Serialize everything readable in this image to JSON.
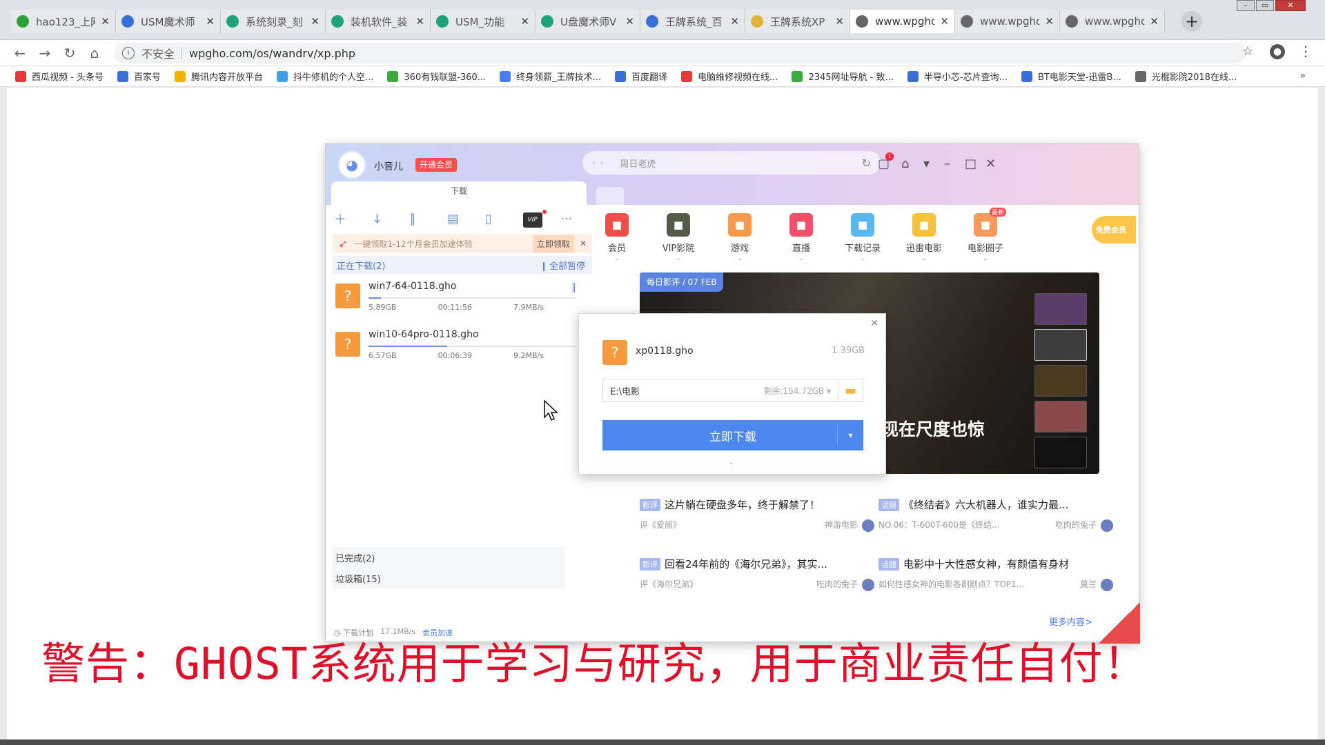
{
  "browser": {
    "tabs": [
      {
        "title": "hao123_上网",
        "icon": "hao123-icon",
        "color": "#2e9e3a"
      },
      {
        "title": "USM魔术师",
        "icon": "paw-icon",
        "color": "#3b6fd8"
      },
      {
        "title": "系统刻录_刻",
        "icon": "edge-e-icon",
        "color": "#1fa37a"
      },
      {
        "title": "装机软件_装",
        "icon": "edge-e-icon",
        "color": "#1fa37a"
      },
      {
        "title": "USM_功能",
        "icon": "edge-e-icon",
        "color": "#1fa37a"
      },
      {
        "title": "U盘魔术师V",
        "icon": "edge-e-icon",
        "color": "#1fa37a"
      },
      {
        "title": "王牌系统_百",
        "icon": "paw-icon",
        "color": "#3b6fd8"
      },
      {
        "title": "王牌系统XP",
        "icon": "folder-icon",
        "color": "#e0b43c"
      },
      {
        "title": "www.wpgho",
        "icon": "globe-icon",
        "color": "#666666"
      },
      {
        "title": "www.wpgho",
        "icon": "globe-icon",
        "color": "#666666"
      },
      {
        "title": "www.wpgho",
        "icon": "globe-icon",
        "color": "#666666"
      }
    ],
    "active_tab": 8,
    "new_tab": "+",
    "address": {
      "insecure": "不安全",
      "url": "wpgho.com/os/wandrv/xp.php"
    },
    "bookmarks": [
      {
        "label": "西瓜视频 - 头条号",
        "color": "#e53935"
      },
      {
        "label": "百家号",
        "color": "#3b6fd8"
      },
      {
        "label": "腾讯内容开放平台",
        "color": "#f0b400"
      },
      {
        "label": "抖牛修机的个人空...",
        "color": "#3ea0e8"
      },
      {
        "label": "360有钱联盟-360...",
        "color": "#3daa3d"
      },
      {
        "label": "终身领薪_王牌技术...",
        "color": "#4a7ef0"
      },
      {
        "label": "百度翻译",
        "color": "#3b6fd8"
      },
      {
        "label": "电脑维修视频在线...",
        "color": "#e53935"
      },
      {
        "label": "2345网址导航 - 致...",
        "color": "#3daa3d"
      },
      {
        "label": "半导小芯-芯片查询...",
        "color": "#3b6fd8"
      },
      {
        "label": "BT电影天堂-迅雷B...",
        "color": "#3b6fd8"
      },
      {
        "label": "光棍影院2018在线...",
        "color": "#666666"
      }
    ],
    "bookmarks_more": "»"
  },
  "app": {
    "user": {
      "name": "小音儿",
      "vip_button": "开通会员"
    },
    "search_placeholder": "周日老虎",
    "download_tab": "下载",
    "promo": {
      "text": "一键领取1-12个月会员加速体验",
      "claim": "立即领取"
    },
    "downloading": {
      "label": "正在下载(2)",
      "pause_all": "全部暂停"
    },
    "tasks": [
      {
        "name": "win7-64-0118.gho",
        "size": "5.89GB",
        "time": "00:11:56",
        "speed": "7.9MB/s",
        "progress": 0.06
      },
      {
        "name": "win10-64pro-0118.gho",
        "size": "6.57GB",
        "time": "00:06:39",
        "speed": "9.2MB/s",
        "progress": 0.38
      }
    ],
    "completed": "已完成(2)",
    "trash": "垃圾箱(15)",
    "footer": {
      "plan": "下载计划",
      "speed": "17.1MB/s",
      "accel": "会员加速"
    },
    "quick": [
      {
        "label": "会员",
        "color": "#f0504a"
      },
      {
        "label": "VIP影院",
        "color": "#555c4a"
      },
      {
        "label": "游戏",
        "color": "#f59a4a"
      },
      {
        "label": "直播",
        "color": "#f0506a"
      },
      {
        "label": "下载记录",
        "color": "#5ab8f0"
      },
      {
        "label": "迅雷电影",
        "color": "#f5c23a"
      },
      {
        "label": "电影圈子",
        "color": "#f59a5a",
        "badge": "最新"
      }
    ],
    "vip_side": "免费会员",
    "banner": {
      "tag": "每日影评 / 07 FEB",
      "text": "现在尺度也惊"
    },
    "news": [
      {
        "badge": "影评",
        "title": "这片躺在硬盘多年，终于解禁了！",
        "sub": "评《爱丽》",
        "author": "神游电影"
      },
      {
        "badge": "话题",
        "title": "《终结者》六大机器人，谁实力最...",
        "sub": "NO.06：T-600T-600是《终结...",
        "author": "吃肉的兔子"
      },
      {
        "badge": "影评",
        "title": "回看24年前的《海尔兄弟》，其实...",
        "sub": "评《海尔兄弟》",
        "author": "吃肉的兔子"
      },
      {
        "badge": "话题",
        "title": "电影中十大性感女神，有颜值有身材",
        "sub": "如何性感女神的电影各剧剧点？TOP1...",
        "author": "莫兰"
      }
    ],
    "more": "更多内容>",
    "dialog": {
      "file": "xp0118.gho",
      "size": "1.39GB",
      "path": "E:\\电影",
      "free": "剩余:154.72GB",
      "button": "立即下载"
    }
  },
  "overlay": {
    "warning": "警告：GHOST系统用于学习与研究，用于商业责任自付！"
  }
}
